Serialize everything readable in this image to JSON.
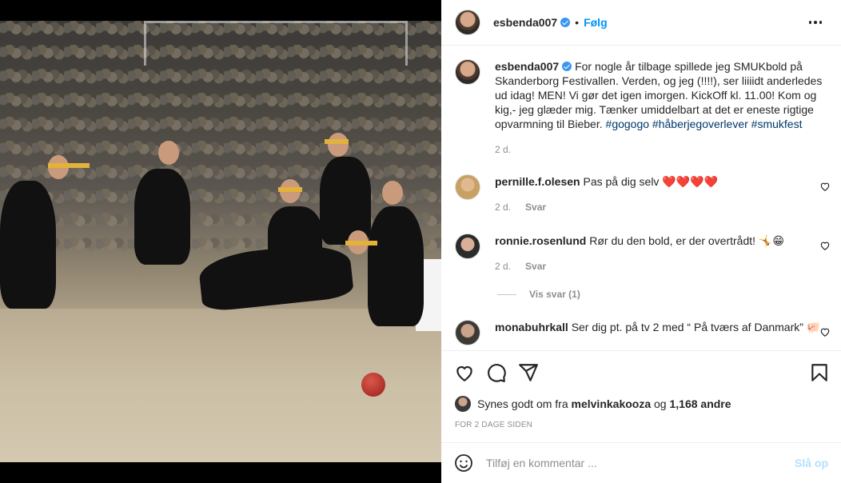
{
  "post": {
    "username": "esbenda007",
    "follow_label": "Følg",
    "dot": "•",
    "caption_text": "For nogle år tilbage spillede jeg SMUKbold på Skanderborg Festivallen. Verden, og jeg (!!!!), ser liiiidt anderledes ud idag! MEN! Vi gør det igen imorgen. KickOff kl. 11.00! Kom og kig,- jeg glæder mig. Tænker umiddelbart at det er eneste rigtige opvarmning til Bieber.",
    "hashtags": "#gogogo #håberjegoverlever #smukfest",
    "caption_age": "2 d."
  },
  "comments": [
    {
      "username": "pernille.f.olesen",
      "text": "Pas på dig selv",
      "emoji": "❤️❤️❤️❤️",
      "age": "2 d.",
      "reply_label": "Svar"
    },
    {
      "username": "ronnie.rosenlund",
      "text": "Rør du den bold, er der overtrådt!",
      "emoji": "🤸😁",
      "age": "2 d.",
      "reply_label": "Svar",
      "view_replies": "Vis svar (1)"
    },
    {
      "username": "monabuhrkall",
      "text": "Ser dig pt. på tv 2 med “ På tværs af Danmark”",
      "emoji": "🐖"
    }
  ],
  "likes": {
    "prefix": "Synes godt om fra",
    "user": "melvinkakooza",
    "middle": "og",
    "count": "1,168 andre"
  },
  "date": "FOR 2 DAGE SIDEN",
  "add_comment": {
    "placeholder": "Tilføj en kommentar ...",
    "post_label": "Slå op"
  },
  "icons": [
    "heart-icon",
    "comment-icon",
    "share-icon",
    "bookmark-icon",
    "emoji-icon",
    "more-icon",
    "verified-icon"
  ],
  "colors": {
    "accent": "#0095f6",
    "post_disabled": "#b2dffc",
    "verified": "#3897f0"
  }
}
